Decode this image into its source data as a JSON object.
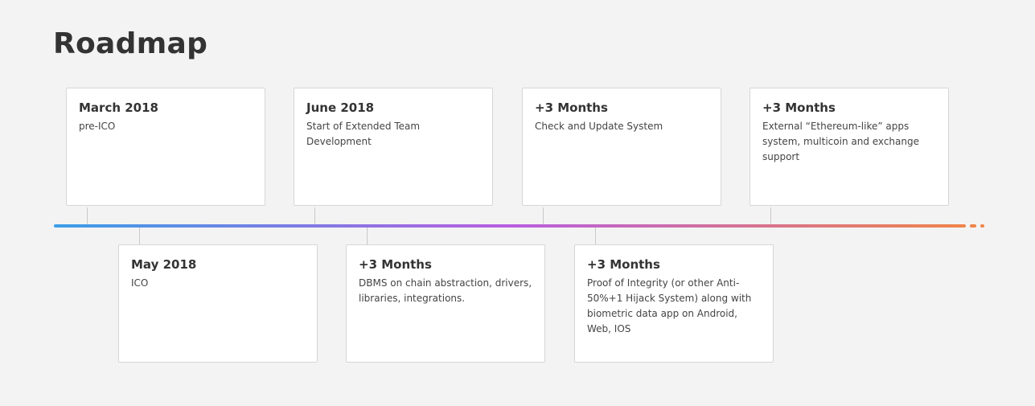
{
  "page": {
    "title": "Roadmap"
  },
  "colors": {
    "background": "#f3f3f3",
    "timeline_start": "#3a9ee8",
    "timeline_mid": "#b85ee0",
    "timeline_end": "#f0844a"
  },
  "milestones_top": [
    {
      "title": "March 2018",
      "description": "pre-ICO"
    },
    {
      "title": "June 2018",
      "description": "Start of Extended Team Development"
    },
    {
      "title": "+3 Months",
      "description": "Check and Update System"
    },
    {
      "title": "+3 Months",
      "description": "External “Ethereum-like” apps system, multicoin and exchange support"
    }
  ],
  "milestones_bottom": [
    {
      "title": "May 2018",
      "description": "ICO"
    },
    {
      "title": "+3 Months",
      "description": "DBMS on chain abstraction, drivers, libraries, integrations."
    },
    {
      "title": "+3 Months",
      "description": "Proof of Integrity (or other Anti-50%+1 Hijack System) along with biometric data app on Android, Web, IOS"
    }
  ]
}
